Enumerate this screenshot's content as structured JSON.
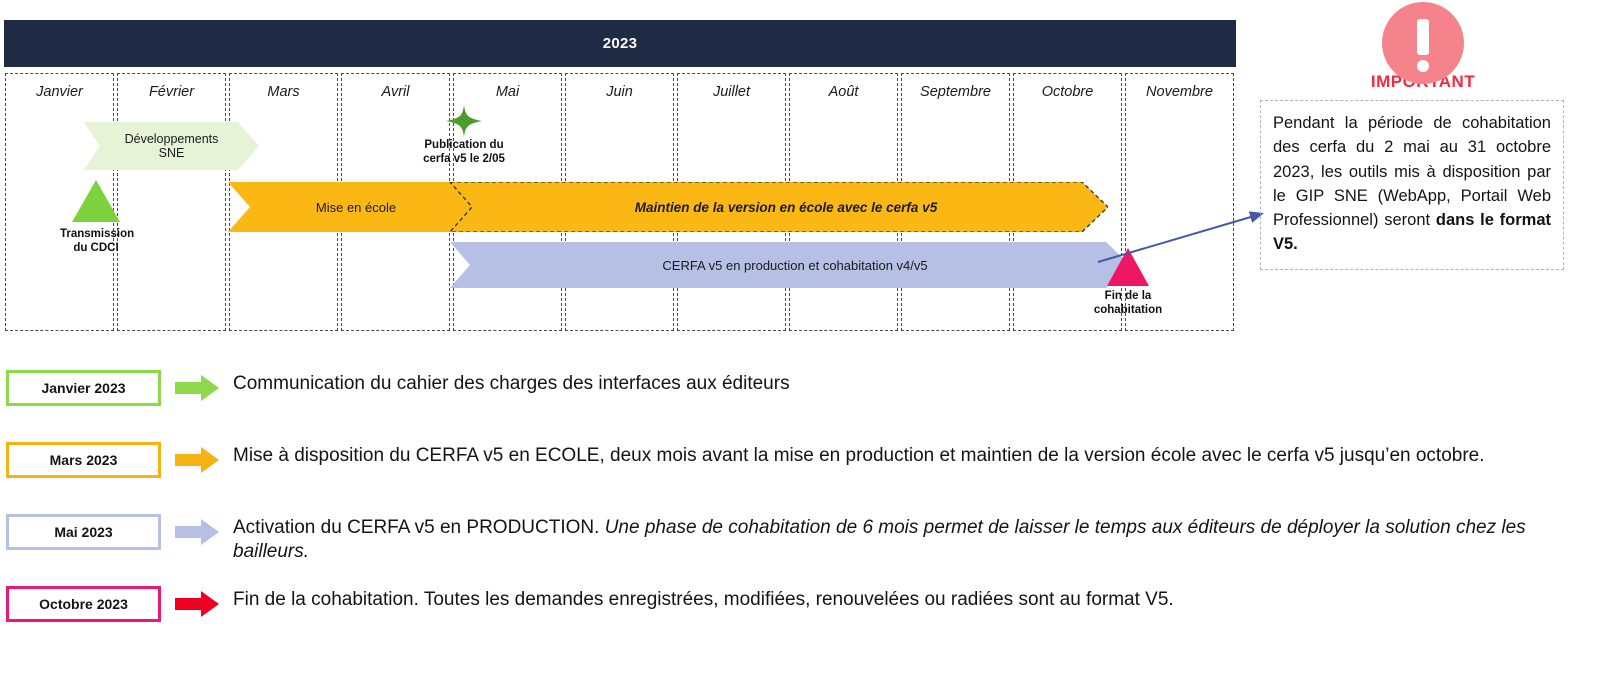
{
  "timeline": {
    "year_header": "2023",
    "months": [
      "Janvier",
      "Février",
      "Mars",
      "Avril",
      "Mai",
      "Juin",
      "Juillet",
      "Août",
      "Septembre",
      "Octobre",
      "Novembre"
    ],
    "dev_sne_label_line1": "Développements",
    "dev_sne_label_line2": "SNE",
    "transmission_line1": "Transmission",
    "transmission_line2": "du CDCI",
    "publication_line1": "Publication du",
    "publication_line2": "cerfa v5 le 2/05",
    "yellow_bar_label_left": "Mise en école",
    "yellow_bar_label_right": "Maintien de la version en école avec le cerfa v5",
    "blue_bar_label": "CERFA v5 en production et cohabitation v4/v5",
    "fin_line1": "Fin de la",
    "fin_line2": "cohabitation"
  },
  "important": {
    "badge_word": "IMPORTANT",
    "text_plain": "Pendant la période de cohabitation des cerfa du 2 mai au 31 octobre 2023, les outils mis à disposition par le GIP SNE (WebApp, Portail Web Professionnel) seront ",
    "text_bold": "dans le format V5."
  },
  "legend": {
    "rows": [
      {
        "chip": "Janvier 2023",
        "text": "Communication du cahier des charges des interfaces aux éditeurs",
        "text_italic": ""
      },
      {
        "chip": "Mars 2023",
        "text": "Mise à disposition du CERFA v5 en ECOLE, deux mois avant la mise en production et maintien de la version école avec le cerfa v5 jusqu’en octobre.",
        "text_italic": ""
      },
      {
        "chip": "Mai 2023",
        "text": "Activation du CERFA v5 en PRODUCTION. ",
        "text_italic": "Une phase de cohabitation de 6 mois permet de laisser le temps aux éditeurs de déployer la solution chez les bailleurs."
      },
      {
        "chip": "Octobre 2023",
        "text": "Fin de la cohabitation. Toutes les demandes enregistrées, modifiées, renouvelées ou radiées sont au format V5.",
        "text_italic": ""
      }
    ]
  },
  "colors": {
    "header_navy": "#1f2a44",
    "green_bright": "#7dd23d",
    "green_pale": "#e6f3d6",
    "green_star": "#4a9c2d",
    "yellow": "#fbb814",
    "blue_lavender": "#b5c0e4",
    "pink_magenta": "#ee1763",
    "red_arrow": "#f00020",
    "important_salmon": "#f4838c",
    "important_red": "#f5283f",
    "connector_blue": "#4558a8",
    "legend_green_border": "#8ed84b",
    "legend_yellow_border": "#f5b212",
    "legend_blue_border": "#b5c0e4",
    "legend_pink_border": "#e8197a"
  }
}
